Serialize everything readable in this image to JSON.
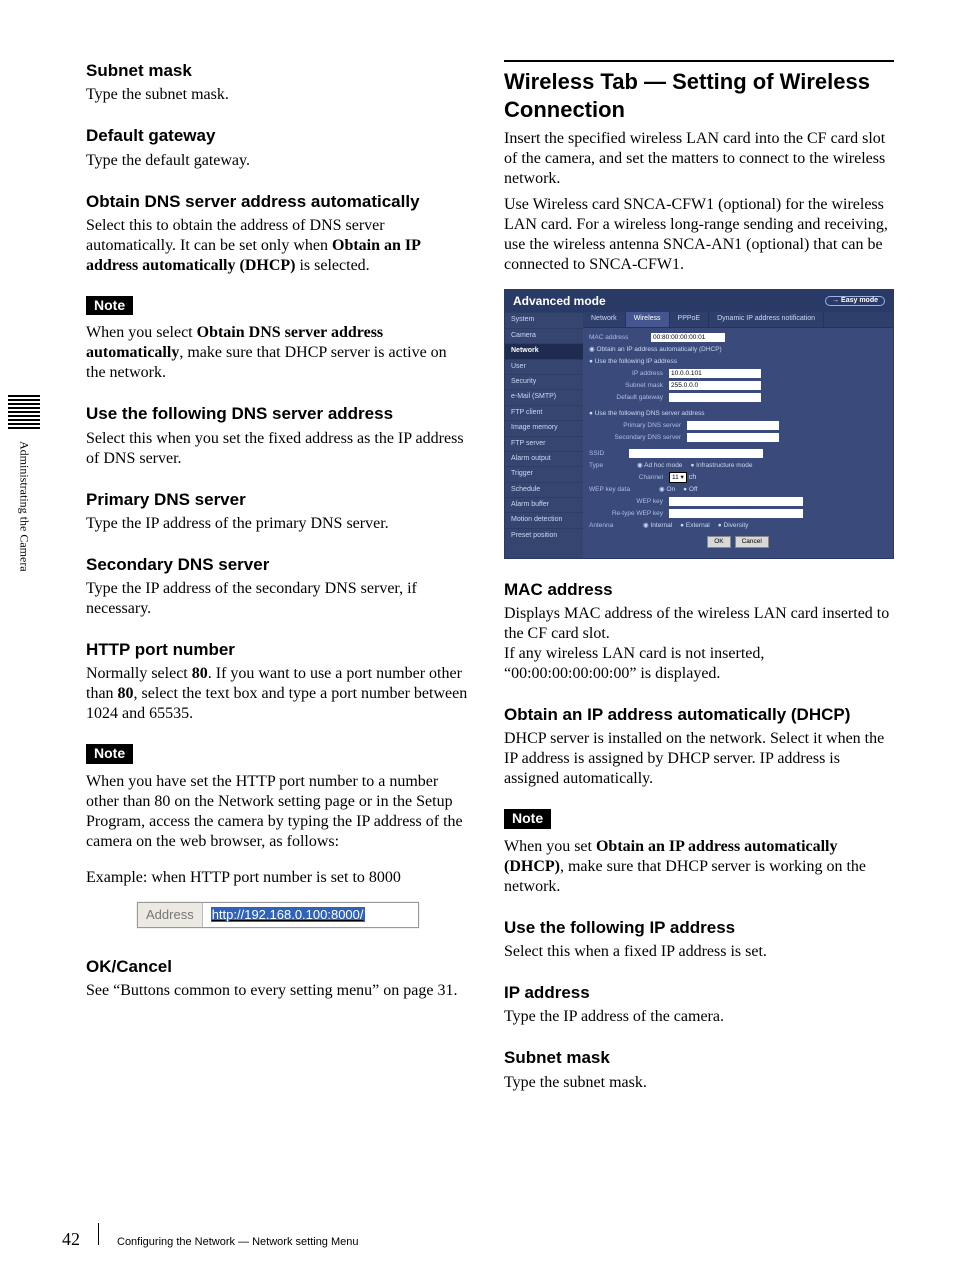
{
  "side_label": "Administrating the Camera",
  "footer": {
    "page": "42",
    "crumb": "Configuring the Network — Network setting Menu"
  },
  "left": {
    "subnet_h": "Subnet mask",
    "subnet_p": "Type the subnet mask.",
    "gw_h": "Default gateway",
    "gw_p": "Type the default gateway.",
    "odns_h": "Obtain DNS server address automatically",
    "odns_p1a": "Select this to obtain the address of DNS server automatically. It can be set only when ",
    "odns_p1b": "Obtain an IP address automatically (DHCP)",
    "odns_p1c": " is selected.",
    "note1": "Note",
    "odns_note_a": "When you select ",
    "odns_note_b": "Obtain DNS server address automatically",
    "odns_note_c": ", make sure that DHCP server is active on the network.",
    "udns_h": "Use the following DNS server address",
    "udns_p": "Select this when you set the fixed address as the IP address of DNS server.",
    "pdns_h": "Primary DNS server",
    "pdns_p": "Type the IP address of the primary DNS server.",
    "sdns_h": "Secondary DNS server",
    "sdns_p": "Type the IP address of the secondary DNS server, if necessary.",
    "http_h": "HTTP port number",
    "http_p_a": "Normally select ",
    "http_p_b": "80",
    "http_p_c": ".   If you want to use a port number other than ",
    "http_p_d": "80",
    "http_p_e": ", select the text box and type a port number between 1024 and 65535.",
    "note2": "Note",
    "http_note": "When you have set the HTTP port number to a number other than 80 on the Network setting page or in the Setup Program, access the camera by typing the IP address of the camera on the web browser, as follows:",
    "http_ex": "Example: when HTTP port number is set to 8000",
    "addr_label": "Address",
    "addr_url": "http://192.168.0.100:8000/",
    "okc_h": "OK/Cancel",
    "okc_p": "See “Buttons common to every setting menu” on page 31."
  },
  "right": {
    "title": "Wireless Tab — Setting of Wireless Connection",
    "intro1": "Insert the specified wireless LAN card into the CF card slot of the camera, and set the matters to connect to the wireless network.",
    "intro2": "Use Wireless card SNCA-CFW1 (optional) for the wireless LAN card. For a wireless long-range sending and receiving, use the wireless antenna SNCA-AN1 (optional) that can be connected to SNCA-CFW1.",
    "mac_h": "MAC address",
    "mac_p1": "Displays MAC address of the wireless LAN card inserted to the CF card slot.",
    "mac_p2": "If any wireless LAN card is not inserted, “00:00:00:00:00:00” is displayed.",
    "dhcp_h": "Obtain an IP address automatically (DHCP)",
    "dhcp_p": "DHCP server is installed on the network. Select it when the IP address is assigned by DHCP server. IP address is assigned automatically.",
    "note3": "Note",
    "dhcp_note_a": "When you set ",
    "dhcp_note_b": "Obtain an IP address automatically (DHCP)",
    "dhcp_note_c": ", make sure that DHCP server is working on the network.",
    "uip_h": "Use the following IP address",
    "uip_p": "Select this when a fixed IP address is set.",
    "ip_h": "IP address",
    "ip_p": "Type the IP address of the camera.",
    "sm_h": "Subnet mask",
    "sm_p": "Type the subnet mask."
  },
  "ui": {
    "title": "Advanced mode",
    "easy": "→ Easy mode",
    "side": [
      "System",
      "Camera",
      "Network",
      "User",
      "Security",
      "e-Mail (SMTP)",
      "FTP client",
      "Image memory",
      "FTP server",
      "Alarm output",
      "Trigger",
      "Schedule",
      "Alarm buffer",
      "Motion detection",
      "Preset position"
    ],
    "side_sel": 2,
    "tabs": [
      "Network",
      "Wireless",
      "PPPoE",
      "Dynamic IP address notification"
    ],
    "tab_sel": 1,
    "mac_lab": "MAC address",
    "mac_val": "00:80:00:00:00:01",
    "dhcp": "Obtain an IP address automatically (DHCP)",
    "useip": "Use the following IP address",
    "ip_lab": "IP address",
    "ip_val": "10.0.0.101",
    "sm_lab": "Subnet mask",
    "sm_val": "255.0.0.0",
    "gw_lab": "Default gateway",
    "usedns": "Use the following DNS server address",
    "dns1_lab": "Primary DNS server",
    "dns2_lab": "Secondary DNS server",
    "ssid_lab": "SSID",
    "type_lab": "Type",
    "type_a": "Ad hoc mode",
    "type_b": "Infrastructure mode",
    "ch_lab": "Channel",
    "ch_val": "11",
    "ch_unit": "ch",
    "wep_lab": "WEP key data",
    "wep_on": "On",
    "wep_off": "Off",
    "wkey_lab": "WEP key",
    "wkey2_lab": "Re-type WEP key",
    "ant_lab": "Antenna",
    "ant_a": "Internal",
    "ant_b": "External",
    "ant_c": "Diversity",
    "ok": "OK",
    "cancel": "Cancel"
  }
}
